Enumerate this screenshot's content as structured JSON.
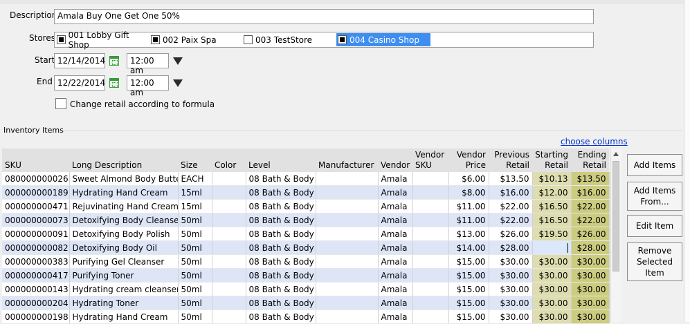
{
  "form": {
    "description_label": "Description",
    "description_value": "Amala Buy One Get One 50%",
    "stores_label": "Stores",
    "stores": [
      {
        "label": "001 Lobby Gift Shop",
        "checked": true,
        "selected": false
      },
      {
        "label": "002 Paix Spa",
        "checked": true,
        "selected": false
      },
      {
        "label": "003 TestStore",
        "checked": false,
        "selected": false
      },
      {
        "label": "004 Casino Shop",
        "checked": true,
        "selected": true
      }
    ],
    "start_label": "Start",
    "start_date": "12/14/2014",
    "start_time": "12:00 am",
    "end_label": "End",
    "end_date": "12/22/2014",
    "end_time": "12:00 am",
    "formula_label": "Change retail according to formula"
  },
  "inventory": {
    "section_title": "Inventory Items",
    "choose_columns": "choose columns",
    "columns": [
      "SKU",
      "Long Description",
      "Size",
      "Color",
      "Level",
      "Manufacturer",
      "Vendor",
      "Vendor SKU",
      "Vendor Price",
      "Previous Retail",
      "Starting Retail",
      "Ending Retail"
    ],
    "rows": [
      [
        "080000000026",
        "Sweet Almond Body Butter",
        "EACH",
        "",
        "08 Bath & Body",
        "",
        "Amala",
        "",
        "$6.00",
        "$13.50",
        "$10.13",
        "$13.50"
      ],
      [
        "000000000189",
        "Hydrating Hand Cream",
        "15ml",
        "",
        "08 Bath & Body",
        "",
        "Amala",
        "",
        "$8.00",
        "$16.00",
        "$12.00",
        "$16.00"
      ],
      [
        "000000000471",
        "Rejuvinating Hand Cream",
        "15ml",
        "",
        "08 Bath & Body",
        "",
        "Amala",
        "",
        "$11.00",
        "$22.00",
        "$16.50",
        "$22.00"
      ],
      [
        "000000000073",
        "Detoxifying Body Cleanse",
        "50ml",
        "",
        "08 Bath & Body",
        "",
        "Amala",
        "",
        "$11.00",
        "$22.00",
        "$16.50",
        "$22.00"
      ],
      [
        "000000000091",
        "Detoxifying Body Polish",
        "50ml",
        "",
        "08 Bath & Body",
        "",
        "Amala",
        "",
        "$13.00",
        "$26.00",
        "$19.50",
        "$26.00"
      ],
      [
        "000000000082",
        "Detoxifying Body Oil",
        "50ml",
        "",
        "08 Bath & Body",
        "",
        "Amala",
        "",
        "$14.00",
        "$28.00",
        "",
        "$28.00"
      ],
      [
        "000000000383",
        "Purifying Gel Cleanser",
        "50ml",
        "",
        "08 Bath & Body",
        "",
        "Amala",
        "",
        "$15.00",
        "$30.00",
        "$30.00",
        "$30.00"
      ],
      [
        "000000000417",
        "Purifying Toner",
        "50ml",
        "",
        "08 Bath & Body",
        "",
        "Amala",
        "",
        "$15.00",
        "$30.00",
        "$30.00",
        "$30.00"
      ],
      [
        "000000000143",
        "Hydrating cream cleanser",
        "50ml",
        "",
        "08 Bath & Body",
        "",
        "Amala",
        "",
        "$15.00",
        "$30.00",
        "$30.00",
        "$30.00"
      ],
      [
        "000000000204",
        "Hydrating Toner",
        "50ml",
        "",
        "08 Bath & Body",
        "",
        "Amala",
        "",
        "$15.00",
        "$30.00",
        "$30.00",
        "$30.00"
      ],
      [
        "000000000198",
        "Hydrating Hand Cream",
        "50ml",
        "",
        "08 Bath & Body",
        "",
        "Amala",
        "",
        "$15.00",
        "$30.00",
        "$30.00",
        "$30.00"
      ]
    ]
  },
  "buttons": {
    "add_items": "Add Items",
    "add_items_from": "Add Items From...",
    "edit_item": "Edit Item",
    "remove_selected": "Remove Selected Item"
  },
  "colors": {
    "row_alt": "#dde5f7",
    "starting_retail_bg": "#ddddb0",
    "ending_retail_bg": "#cccc80",
    "selected_store": "#3d8ef0",
    "link": "#0033cc"
  }
}
